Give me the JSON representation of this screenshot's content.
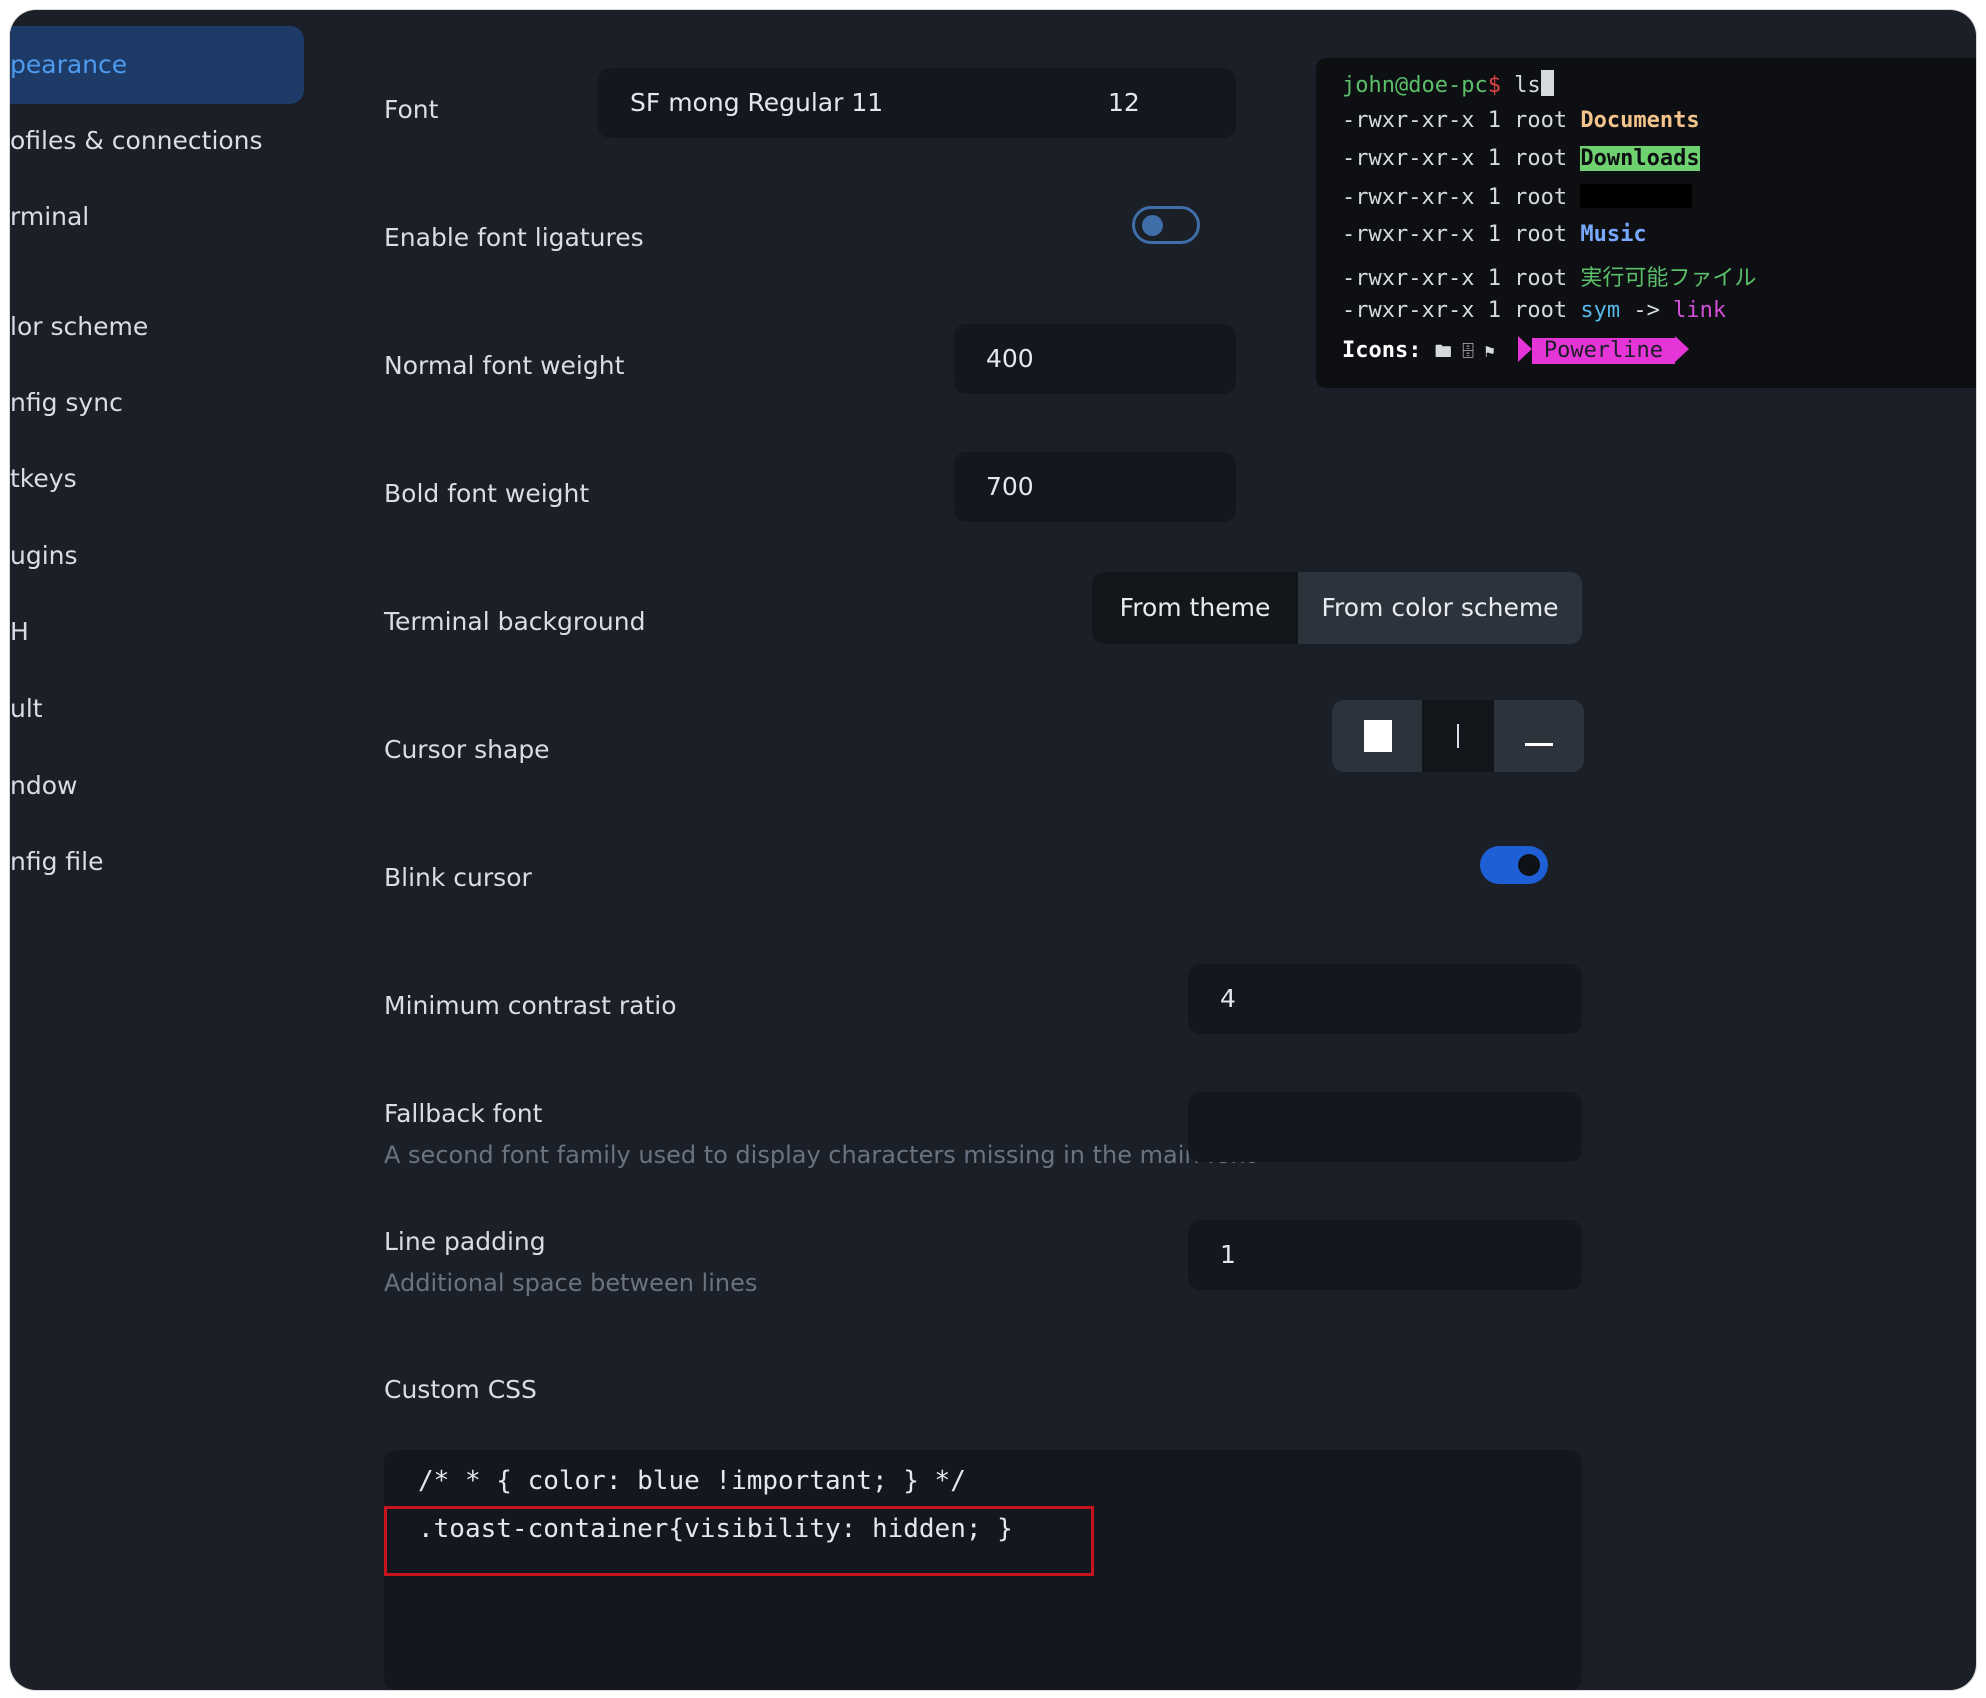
{
  "sidebar": {
    "items": [
      {
        "label": "pearance",
        "active": true
      },
      {
        "label": "ofiles & connections"
      },
      {
        "label": "rminal"
      },
      {
        "label": "lor scheme"
      },
      {
        "label": "nfig sync"
      },
      {
        "label": "tkeys"
      },
      {
        "label": "ugins"
      },
      {
        "label": "H"
      },
      {
        "label": "ult"
      },
      {
        "label": "ndow"
      },
      {
        "label": "nfig file"
      }
    ]
  },
  "settings": {
    "font": {
      "label": "Font",
      "value": "SF mong Regular 11",
      "size": "12"
    },
    "ligatures": {
      "label": "Enable font ligatures",
      "enabled": false
    },
    "normal_weight": {
      "label": "Normal font weight",
      "value": "400"
    },
    "bold_weight": {
      "label": "Bold font weight",
      "value": "700"
    },
    "terminal_background": {
      "label": "Terminal background",
      "options": [
        "From theme",
        "From color scheme"
      ],
      "selected": "From color scheme"
    },
    "cursor_shape": {
      "label": "Cursor shape",
      "options": [
        "block",
        "beam",
        "underline"
      ],
      "selected": "underline"
    },
    "blink": {
      "label": "Blink cursor",
      "enabled": true
    },
    "min_contrast": {
      "label": "Minimum contrast ratio",
      "value": "4"
    },
    "fallback_font": {
      "label": "Fallback font",
      "description": "A second font family used to display characters missing in the main font",
      "value": ""
    },
    "line_padding": {
      "label": "Line padding",
      "description": "Additional space between lines",
      "value": "1"
    },
    "custom_css": {
      "label": "Custom CSS",
      "lines": [
        "/* * { color: blue !important; } */",
        ".toast-container{visibility: hidden; }"
      ]
    }
  },
  "terminal_preview": {
    "prompt_user": "john@doe-pc",
    "prompt_symbol": "$",
    "command": "ls",
    "perm": "-rwxr-xr-x 1 root",
    "entries": [
      "Documents",
      "Downloads",
      "",
      "Music",
      "実行可能ファイル",
      "sym",
      "->",
      "link"
    ],
    "icons_label": "Icons:",
    "icons_glyphs": "🖿 🗄 ⚑",
    "powerline": "Powerline"
  },
  "colors": {
    "accent": "#4d9bf0",
    "toggle_on": "#1f5fd6",
    "powerline": "#e535d6",
    "highlight_border": "#c4141c"
  }
}
